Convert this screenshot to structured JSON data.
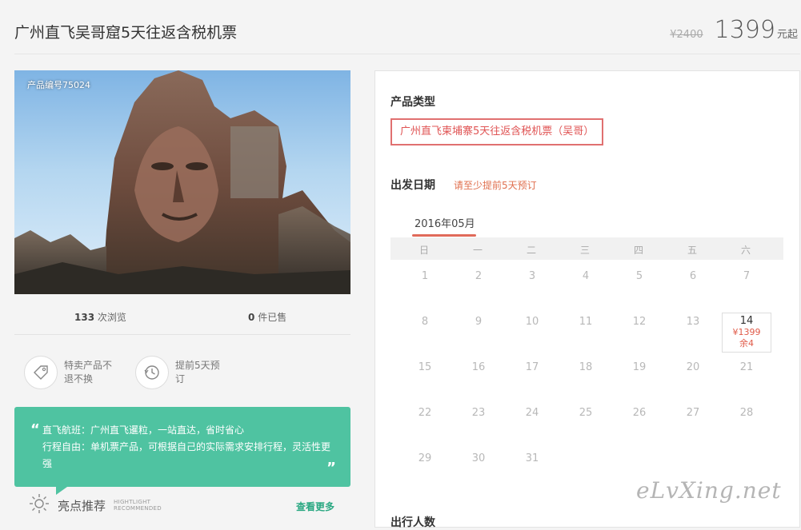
{
  "header": {
    "title": "广州直飞吴哥窟5天往返含税机票",
    "old_price": "¥2400",
    "price": "1399",
    "price_unit": "元起"
  },
  "hero": {
    "product_no": "产品编号75024"
  },
  "stats": {
    "views_count": "133",
    "views_label": "次浏览",
    "sold_count": "0",
    "sold_label": "件已售"
  },
  "features": [
    {
      "icon": "tag-icon",
      "label": "特卖产品不退不换"
    },
    {
      "icon": "history-clock-icon",
      "label": "提前5天预订"
    }
  ],
  "highlight_box": {
    "line1": "直飞航班：广州直飞暹粒，一站直达，省时省心",
    "line2": "行程自由：单机票产品，可根据自己的实际需求安排行程，灵活性更强",
    "open_quote": "“",
    "close_quote": "”"
  },
  "highlight_footer": {
    "icon": "sun-icon",
    "title": "亮点推荐",
    "en_line1": "HIGHTLIGHT",
    "en_line2": "RECOMMENDED",
    "see_more": "查看更多"
  },
  "panel": {
    "type_title": "产品类型",
    "type_option": "广州直飞柬埔寨5天往返含税机票（吴哥）",
    "date_title": "出发日期",
    "date_hint": "请至少提前5天预订",
    "month": "2016年05月",
    "weekdays": [
      "日",
      "一",
      "二",
      "三",
      "四",
      "五",
      "六"
    ],
    "days": [
      "1",
      "2",
      "3",
      "4",
      "5",
      "6",
      "7",
      "8",
      "9",
      "10",
      "11",
      "12",
      "13",
      "14",
      "15",
      "16",
      "17",
      "18",
      "19",
      "20",
      "21",
      "22",
      "23",
      "24",
      "25",
      "26",
      "27",
      "28",
      "29",
      "30",
      "31"
    ],
    "active_day": {
      "day": "14",
      "price": "¥1399",
      "remain": "余4"
    },
    "next_section_partial": "出行人数"
  },
  "watermark": "eLvXing.net",
  "colors": {
    "accent_red": "#e05a48",
    "green_box": "#4fc3a1",
    "see_more": "#2aa882"
  }
}
